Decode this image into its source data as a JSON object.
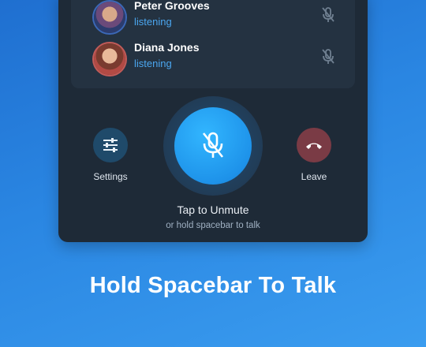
{
  "participants": [
    {
      "name": "Peter Grooves",
      "status": "listening",
      "avatar_icon": "avatar-peter"
    },
    {
      "name": "Diana Jones",
      "status": "listening",
      "avatar_icon": "avatar-diana"
    }
  ],
  "controls": {
    "settings_label": "Settings",
    "leave_label": "Leave",
    "mute_icon": "microphone-muted-icon"
  },
  "prompt": {
    "primary": "Tap to Unmute",
    "secondary": "or hold spacebar to talk"
  },
  "caption": "Hold Spacebar To Talk",
  "colors": {
    "accent": "#1e93ea",
    "status": "#4ba7f0",
    "leave": "#7a3b45",
    "settings": "#1f4a6a"
  }
}
